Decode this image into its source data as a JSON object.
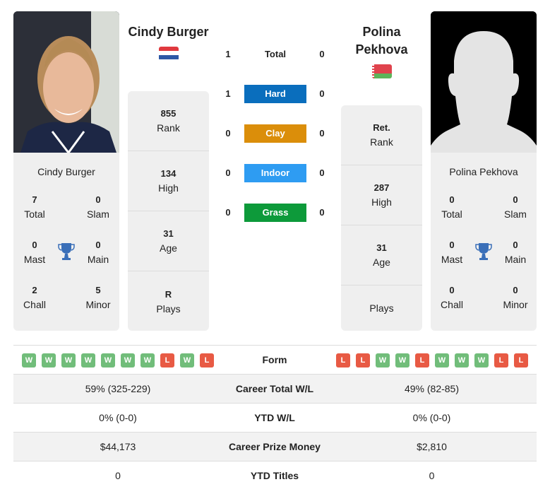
{
  "colors": {
    "hard": "#0a6ebd",
    "clay": "#db8e0a",
    "indoor": "#2e9cf2",
    "grass": "#0d9a3a",
    "win": "#71bd7a",
    "loss": "#e85a44",
    "trophy": "#3a6fb8"
  },
  "player1": {
    "name": "Cindy Burger",
    "flag": "netherlands-flag",
    "card_name": "Cindy Burger",
    "titles": {
      "total": {
        "value": "7",
        "label": "Total"
      },
      "slam": {
        "value": "0",
        "label": "Slam"
      },
      "mast": {
        "value": "0",
        "label": "Mast"
      },
      "main": {
        "value": "0",
        "label": "Main"
      },
      "chall": {
        "value": "2",
        "label": "Chall"
      },
      "minor": {
        "value": "5",
        "label": "Minor"
      }
    },
    "stats": [
      {
        "value": "855",
        "label": "Rank"
      },
      {
        "value": "134",
        "label": "High"
      },
      {
        "value": "31",
        "label": "Age"
      },
      {
        "value": "R",
        "label": "Plays"
      }
    ],
    "form": [
      "W",
      "W",
      "W",
      "W",
      "W",
      "W",
      "W",
      "L",
      "W",
      "L"
    ]
  },
  "player2": {
    "name_line1": "Polina",
    "name_line2": "Pekhova",
    "flag": "belarus-flag",
    "card_name": "Polina Pekhova",
    "titles": {
      "total": {
        "value": "0",
        "label": "Total"
      },
      "slam": {
        "value": "0",
        "label": "Slam"
      },
      "mast": {
        "value": "0",
        "label": "Mast"
      },
      "main": {
        "value": "0",
        "label": "Main"
      },
      "chall": {
        "value": "0",
        "label": "Chall"
      },
      "minor": {
        "value": "0",
        "label": "Minor"
      }
    },
    "stats": [
      {
        "value": "Ret.",
        "label": "Rank"
      },
      {
        "value": "287",
        "label": "High"
      },
      {
        "value": "31",
        "label": "Age"
      },
      {
        "value": "",
        "label": "Plays"
      }
    ],
    "form": [
      "L",
      "L",
      "W",
      "W",
      "L",
      "W",
      "W",
      "W",
      "L",
      "L"
    ]
  },
  "h2h": [
    {
      "label": "Total",
      "p1": "1",
      "p2": "0",
      "type": "total"
    },
    {
      "label": "Hard",
      "p1": "1",
      "p2": "0",
      "type": "hard"
    },
    {
      "label": "Clay",
      "p1": "0",
      "p2": "0",
      "type": "clay"
    },
    {
      "label": "Indoor",
      "p1": "0",
      "p2": "0",
      "type": "indoor"
    },
    {
      "label": "Grass",
      "p1": "0",
      "p2": "0",
      "type": "grass"
    }
  ],
  "table": {
    "form_label": "Form",
    "rows": [
      {
        "label": "Career Total W/L",
        "p1": "59% (325-229)",
        "p2": "49% (82-85)"
      },
      {
        "label": "YTD W/L",
        "p1": "0% (0-0)",
        "p2": "0% (0-0)"
      },
      {
        "label": "Career Prize Money",
        "p1": "$44,173",
        "p2": "$2,810"
      },
      {
        "label": "YTD Titles",
        "p1": "0",
        "p2": "0"
      }
    ]
  }
}
